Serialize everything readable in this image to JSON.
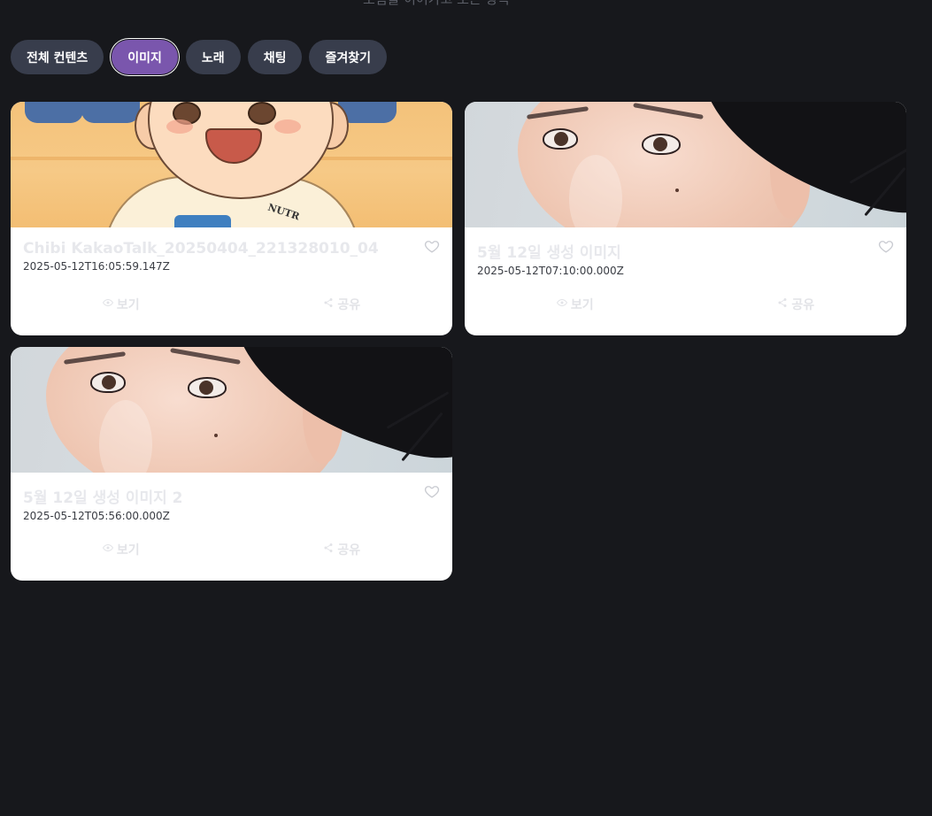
{
  "header": {
    "subtitle": "모험을 이어가고 모든 항목"
  },
  "tabs": [
    {
      "label": "전체 컨텐츠",
      "active": false
    },
    {
      "label": "이미지",
      "active": true
    },
    {
      "label": "노래",
      "active": false
    },
    {
      "label": "채팅",
      "active": false
    },
    {
      "label": "즐겨찾기",
      "active": false
    }
  ],
  "cards": [
    {
      "title": "Chibi KakaoTalk_20250404_221328010_04",
      "date": "2025-05-12T16:05:59.147Z",
      "view_label": "보기",
      "share_label": "공유",
      "thumbnail": "chibi-illustration",
      "thumbnail_text": "NUTR"
    },
    {
      "title": "5월 12일 생성 이미지",
      "date": "2025-05-12T07:10:00.000Z",
      "view_label": "보기",
      "share_label": "공유",
      "thumbnail": "portrait-photo"
    },
    {
      "title": "5월 12일 생성 이미지 2",
      "date": "2025-05-12T05:56:00.000Z",
      "view_label": "보기",
      "share_label": "공유",
      "thumbnail": "portrait-photo"
    }
  ],
  "colors": {
    "background": "#17181c",
    "tab": "#383d4c",
    "tab_active": "#7a56ad",
    "card": "#ffffff"
  },
  "icons": [
    "heart-icon",
    "eye-icon",
    "share-icon"
  ]
}
